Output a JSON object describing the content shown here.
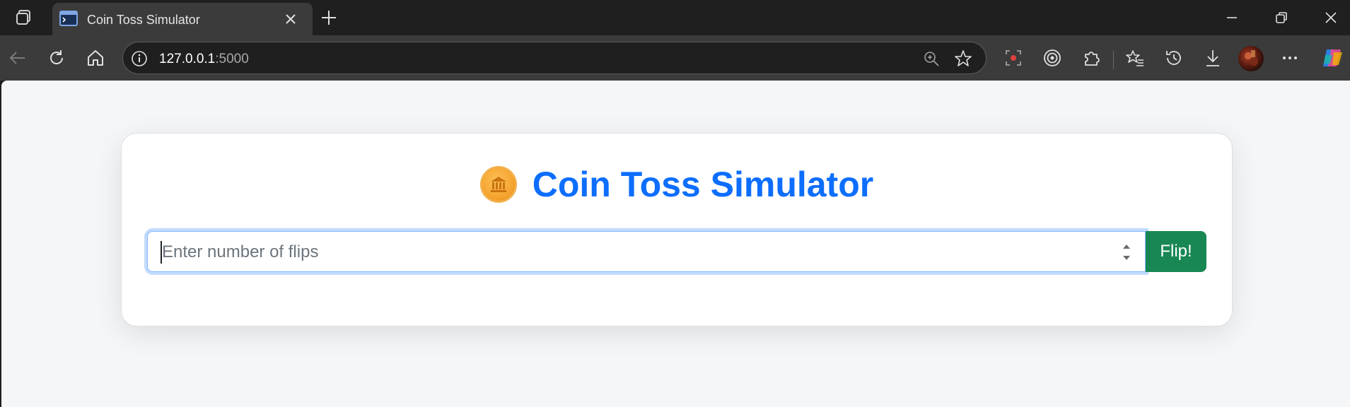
{
  "browser": {
    "tab": {
      "title": "Coin Toss Simulator"
    },
    "address": {
      "host": "127.0.0.1",
      "port": ":5000"
    },
    "icons": {
      "workspaces": "workspaces-icon",
      "favicon": "terminal-window-icon",
      "close": "close-icon",
      "new_tab": "plus-icon",
      "back": "back-arrow-icon",
      "reload": "reload-icon",
      "home": "home-icon",
      "site_info": "info-icon",
      "zoom": "zoom-icon",
      "favorite": "star-icon",
      "screenshot": "screen-capture-icon",
      "tracking": "tracking-prevention-icon",
      "extensions": "puzzle-icon",
      "favorites": "favorites-icon",
      "history": "history-icon",
      "downloads": "download-icon",
      "more": "more-icon",
      "copilot": "copilot-icon"
    }
  },
  "page": {
    "title": "Coin Toss Simulator",
    "coin_icon": "bank-coin-icon",
    "input": {
      "placeholder": "Enter number of flips",
      "value": ""
    },
    "button": {
      "label": "Flip!"
    },
    "colors": {
      "accent": "#0d6efd",
      "button": "#198754",
      "coin": "#f5a530"
    }
  }
}
